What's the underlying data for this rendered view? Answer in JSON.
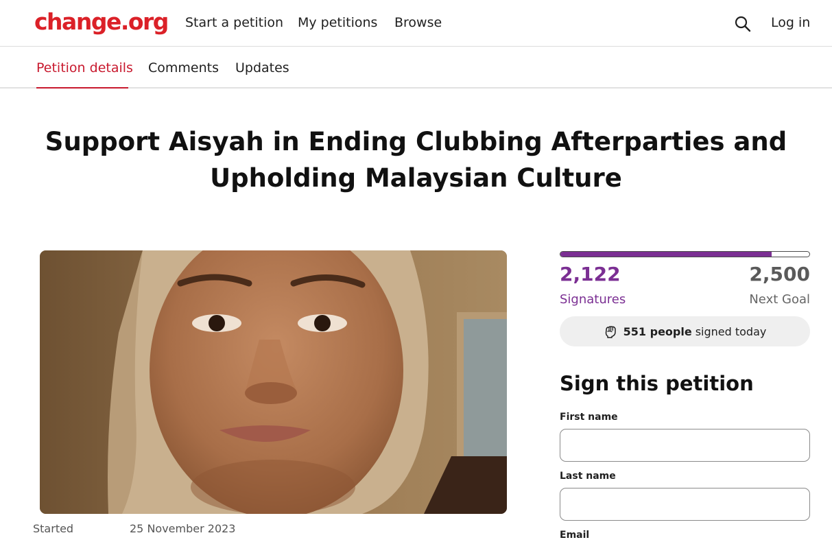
{
  "header": {
    "logo": "change.org",
    "nav": [
      "Start a petition",
      "My petitions",
      "Browse"
    ],
    "search_icon": "search-icon",
    "login": "Log in"
  },
  "tabs": {
    "items": [
      "Petition details",
      "Comments",
      "Updates"
    ],
    "active": "Petition details"
  },
  "petition": {
    "title": "Support Aisyah in Ending Clubbing Afterparties and Upholding Malaysian Culture",
    "started_label": "Started",
    "started_date": "25 November 2023"
  },
  "progress": {
    "signatures": "2,122",
    "signatures_label": "Signatures",
    "goal": "2,500",
    "goal_label": "Next Goal",
    "fraction": 0.8488
  },
  "today": {
    "icon": "fist-icon",
    "count_text": "551 people",
    "rest_text": "signed today"
  },
  "form": {
    "heading": "Sign this petition",
    "first_name_label": "First name",
    "last_name_label": "Last name",
    "email_label": "Email",
    "first_name_value": "",
    "last_name_value": ""
  },
  "colors": {
    "brand_red": "#db2128",
    "tab_active": "#c8192e",
    "progress_purple": "#7b2f93"
  }
}
